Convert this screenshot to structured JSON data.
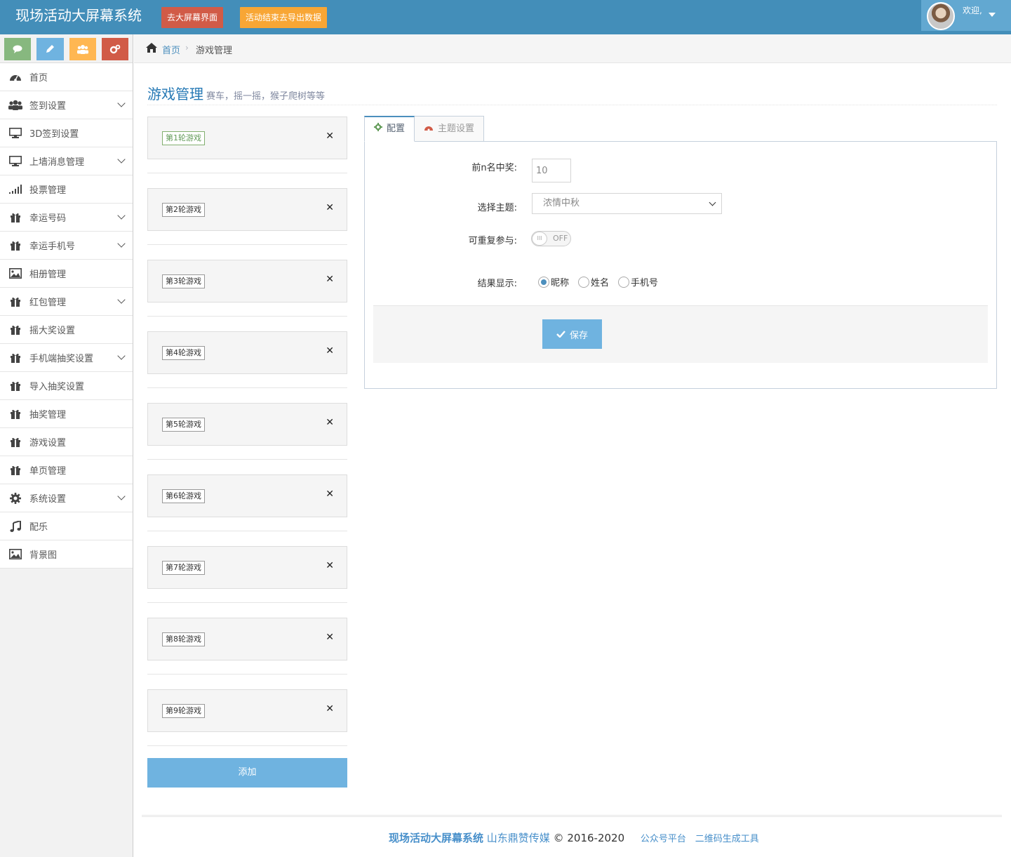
{
  "navbar": {
    "brand": "现场活动大屏幕系统",
    "btn_screen": "去大屏幕界面",
    "btn_export": "活动结束去导出数据",
    "welcome": "欢迎,"
  },
  "shortcuts": [
    {
      "icon": "comment-icon",
      "color": "#87b87f"
    },
    {
      "icon": "pencil-icon",
      "color": "#6fb3e0"
    },
    {
      "icon": "users-icon",
      "color": "#ffb752"
    },
    {
      "icon": "cogs-icon",
      "color": "#d15b47"
    }
  ],
  "sidebar": {
    "items": [
      {
        "label": "首页",
        "icon": "dashboard-icon",
        "has_submenu": false
      },
      {
        "label": "签到设置",
        "icon": "users-icon",
        "has_submenu": true
      },
      {
        "label": "3D签到设置",
        "icon": "desktop-icon",
        "has_submenu": false
      },
      {
        "label": "上墙消息管理",
        "icon": "desktop-icon",
        "has_submenu": true
      },
      {
        "label": "投票管理",
        "icon": "signal-icon",
        "has_submenu": false
      },
      {
        "label": "幸运号码",
        "icon": "gift-icon",
        "has_submenu": true
      },
      {
        "label": "幸运手机号",
        "icon": "gift-icon",
        "has_submenu": true
      },
      {
        "label": "相册管理",
        "icon": "picture-icon",
        "has_submenu": false
      },
      {
        "label": "红包管理",
        "icon": "gift-icon",
        "has_submenu": true
      },
      {
        "label": "摇大奖设置",
        "icon": "gift-icon",
        "has_submenu": false
      },
      {
        "label": "手机端抽奖设置",
        "icon": "gift-icon",
        "has_submenu": true
      },
      {
        "label": "导入抽奖设置",
        "icon": "gift-icon",
        "has_submenu": false
      },
      {
        "label": "抽奖管理",
        "icon": "gift-icon",
        "has_submenu": false
      },
      {
        "label": "游戏设置",
        "icon": "gift-icon",
        "has_submenu": false
      },
      {
        "label": "单页管理",
        "icon": "gift-icon",
        "has_submenu": false
      },
      {
        "label": "系统设置",
        "icon": "cog-icon",
        "has_submenu": true
      },
      {
        "label": "配乐",
        "icon": "music-icon",
        "has_submenu": false
      },
      {
        "label": "背景图",
        "icon": "picture-icon",
        "has_submenu": false
      }
    ]
  },
  "breadcrumb": {
    "home": "首页",
    "current": "游戏管理"
  },
  "page_header": {
    "title": "游戏管理",
    "subtitle": "赛车，摇一摇，猴子爬树等等"
  },
  "rounds": [
    {
      "label": "第1轮游戏",
      "active": true
    },
    {
      "label": "第2轮游戏",
      "active": false
    },
    {
      "label": "第3轮游戏",
      "active": false
    },
    {
      "label": "第4轮游戏",
      "active": false
    },
    {
      "label": "第5轮游戏",
      "active": false
    },
    {
      "label": "第6轮游戏",
      "active": false
    },
    {
      "label": "第7轮游戏",
      "active": false
    },
    {
      "label": "第8轮游戏",
      "active": false
    },
    {
      "label": "第9轮游戏",
      "active": false
    }
  ],
  "add_label": "添加",
  "tabs": [
    {
      "label": "配置",
      "icon": "cog-icon",
      "active": true
    },
    {
      "label": "主题设置",
      "icon": "dashboard-icon",
      "active": false
    }
  ],
  "form": {
    "top_n_label": "前n名中奖:",
    "top_n_value": "10",
    "theme_label": "选择主题:",
    "theme_value": "浓情中秋",
    "repeat_label": "可重复参与:",
    "repeat_state": "OFF",
    "result_label": "结果显示:",
    "result_options": [
      "昵称",
      "姓名",
      "手机号"
    ],
    "result_selected": "昵称",
    "save_label": "保存"
  },
  "footer": {
    "brand": "现场活动大屏幕系统",
    "company": "山东鼎赞传媒",
    "copyright": "© 2016-2020",
    "link1": "公众号平台",
    "link2": "二维码生成工具"
  }
}
